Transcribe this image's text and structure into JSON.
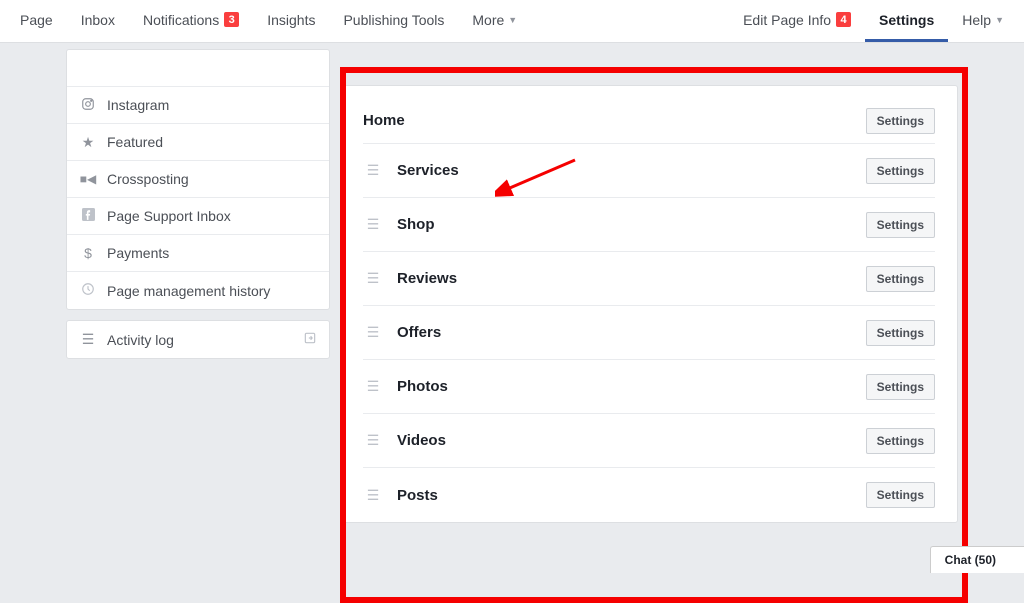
{
  "nav": {
    "page": "Page",
    "inbox": "Inbox",
    "notifications": "Notifications",
    "notifications_badge": "3",
    "insights": "Insights",
    "publishing": "Publishing Tools",
    "more": "More",
    "edit_info": "Edit Page Info",
    "edit_info_badge": "4",
    "settings": "Settings",
    "help": "Help"
  },
  "sidebar": {
    "instagram": "Instagram",
    "featured": "Featured",
    "crossposting": "Crossposting",
    "support_inbox": "Page Support Inbox",
    "payments": "Payments",
    "mgmt_history": "Page management history",
    "activity_log": "Activity log"
  },
  "tabs": {
    "settings_btn": "Settings",
    "home": "Home",
    "services": "Services",
    "shop": "Shop",
    "reviews": "Reviews",
    "offers": "Offers",
    "photos": "Photos",
    "videos": "Videos",
    "posts": "Posts"
  },
  "chat": {
    "label": "Chat (50)"
  }
}
